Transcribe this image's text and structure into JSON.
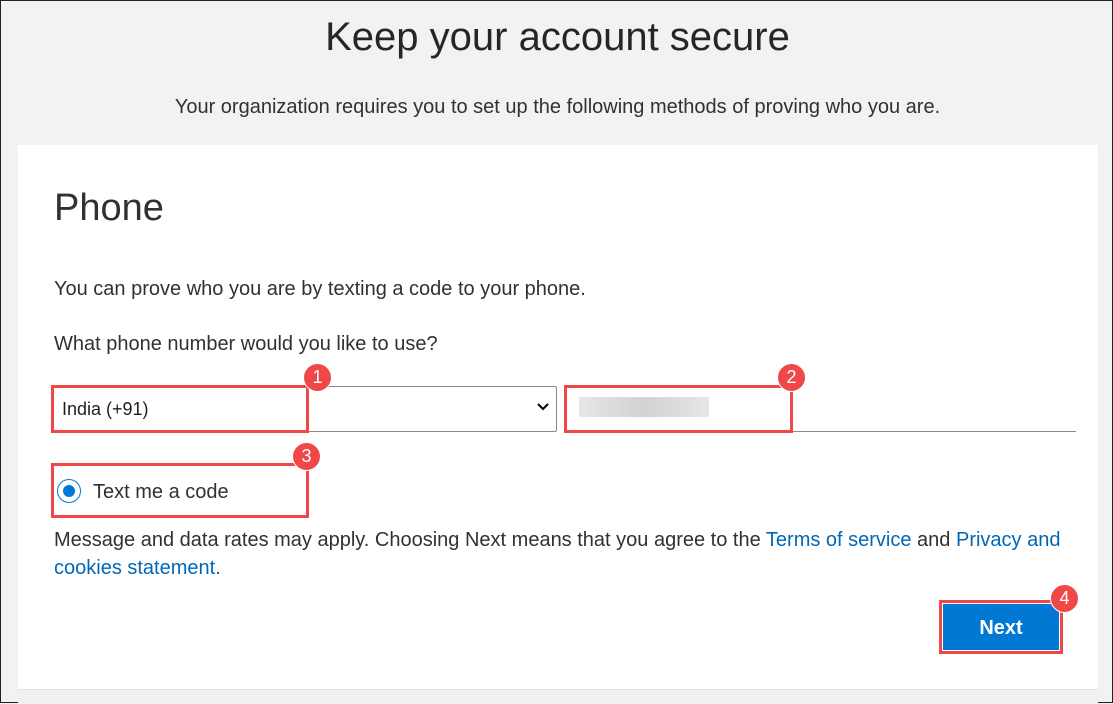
{
  "header": {
    "title": "Keep your account secure",
    "subtitle": "Your organization requires you to set up the following methods of proving who you are."
  },
  "card": {
    "heading": "Phone",
    "description": "You can prove who you are by texting a code to your phone.",
    "question": "What phone number would you like to use?",
    "country_select": {
      "selected": "India (+91)"
    },
    "phone_input": {
      "value": ""
    },
    "radio_option": {
      "label": "Text me a code",
      "checked": true
    },
    "disclaimer": {
      "text_before": "Message and data rates may apply. Choosing Next means that you agree to the ",
      "terms_link": "Terms of service",
      "and": " and ",
      "privacy_link": "Privacy and cookies statement."
    },
    "next_label": "Next"
  },
  "annotations": [
    "1",
    "2",
    "3",
    "4"
  ],
  "colors": {
    "accent": "#0078d4",
    "annotation": "#f04848",
    "link": "#0067b8"
  }
}
